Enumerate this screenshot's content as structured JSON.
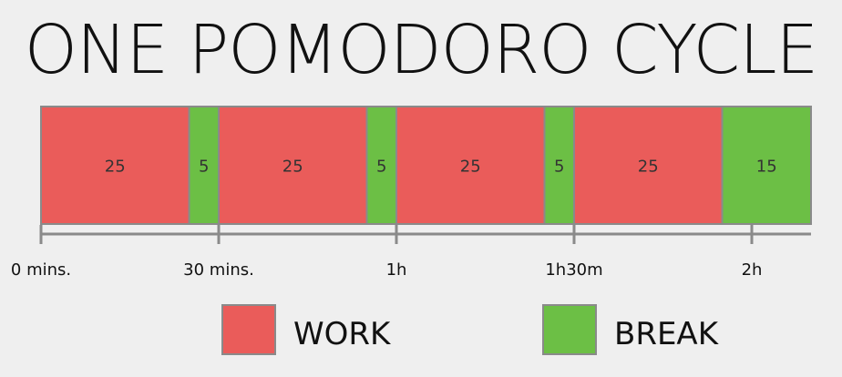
{
  "title": "ONE POMODORO CYCLE",
  "colors": {
    "work": "#ea5c5a",
    "break": "#6cbf45",
    "border": "#8a8a8a",
    "axis": "#8a8a8a"
  },
  "segments": [
    {
      "type": "work",
      "minutes": 25,
      "label": "25"
    },
    {
      "type": "break",
      "minutes": 5,
      "label": "5"
    },
    {
      "type": "work",
      "minutes": 25,
      "label": "25"
    },
    {
      "type": "break",
      "minutes": 5,
      "label": "5"
    },
    {
      "type": "work",
      "minutes": 25,
      "label": "25"
    },
    {
      "type": "break",
      "minutes": 5,
      "label": "5"
    },
    {
      "type": "work",
      "minutes": 25,
      "label": "25"
    },
    {
      "type": "break",
      "minutes": 15,
      "label": "15"
    }
  ],
  "ticks": [
    {
      "minutes": 0,
      "label": "0 mins."
    },
    {
      "minutes": 30,
      "label": "30 mins."
    },
    {
      "minutes": 60,
      "label": "1h"
    },
    {
      "minutes": 90,
      "label": "1h30m"
    },
    {
      "minutes": 120,
      "label": "2h"
    }
  ],
  "legend": {
    "work_label": "WORK",
    "break_label": "BREAK"
  }
}
